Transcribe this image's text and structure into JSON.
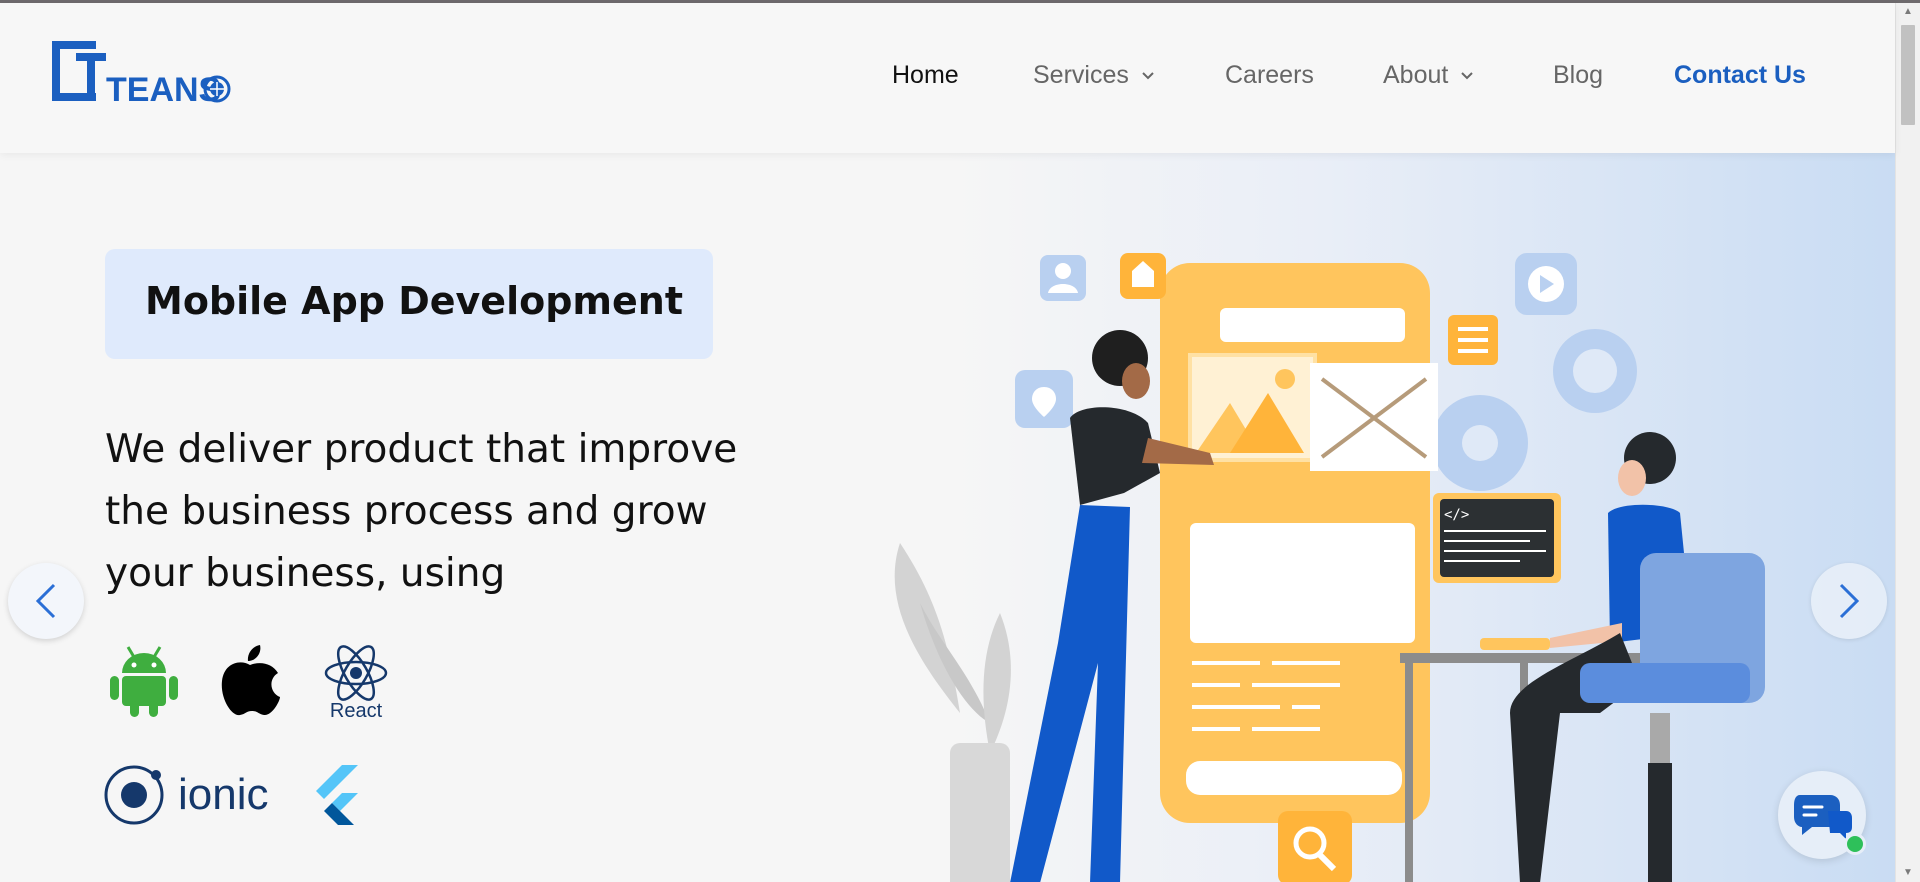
{
  "header": {
    "logo_text": "TEANS",
    "nav": [
      {
        "label": "Home",
        "icon": null,
        "active": true
      },
      {
        "label": "Services",
        "icon": "chevron-down-icon",
        "active": false
      },
      {
        "label": "Careers",
        "icon": null,
        "active": false
      },
      {
        "label": "About",
        "icon": "chevron-down-icon",
        "active": false
      },
      {
        "label": "Blog",
        "icon": null,
        "active": false
      },
      {
        "label": "Contact Us",
        "icon": null,
        "active": false
      }
    ]
  },
  "hero": {
    "tag": "Mobile App Development",
    "lines": [
      "We deliver product that improve",
      "the business process and grow",
      "your business, using"
    ],
    "tech": [
      {
        "name": "android-icon"
      },
      {
        "name": "apple-icon"
      },
      {
        "name": "react-icon",
        "label": "React"
      },
      {
        "name": "ionic-icon",
        "label": "ionic"
      },
      {
        "name": "flutter-icon"
      }
    ],
    "prev_icon": "chevron-left-icon",
    "next_icon": "chevron-right-icon"
  },
  "colors": {
    "brand_blue": "#1b5fc0",
    "tag_bg": "#dfeafc",
    "illustration_orange": "#ffc55d",
    "illustration_blue": "#1159c9",
    "chat_green": "#2ec05a"
  }
}
